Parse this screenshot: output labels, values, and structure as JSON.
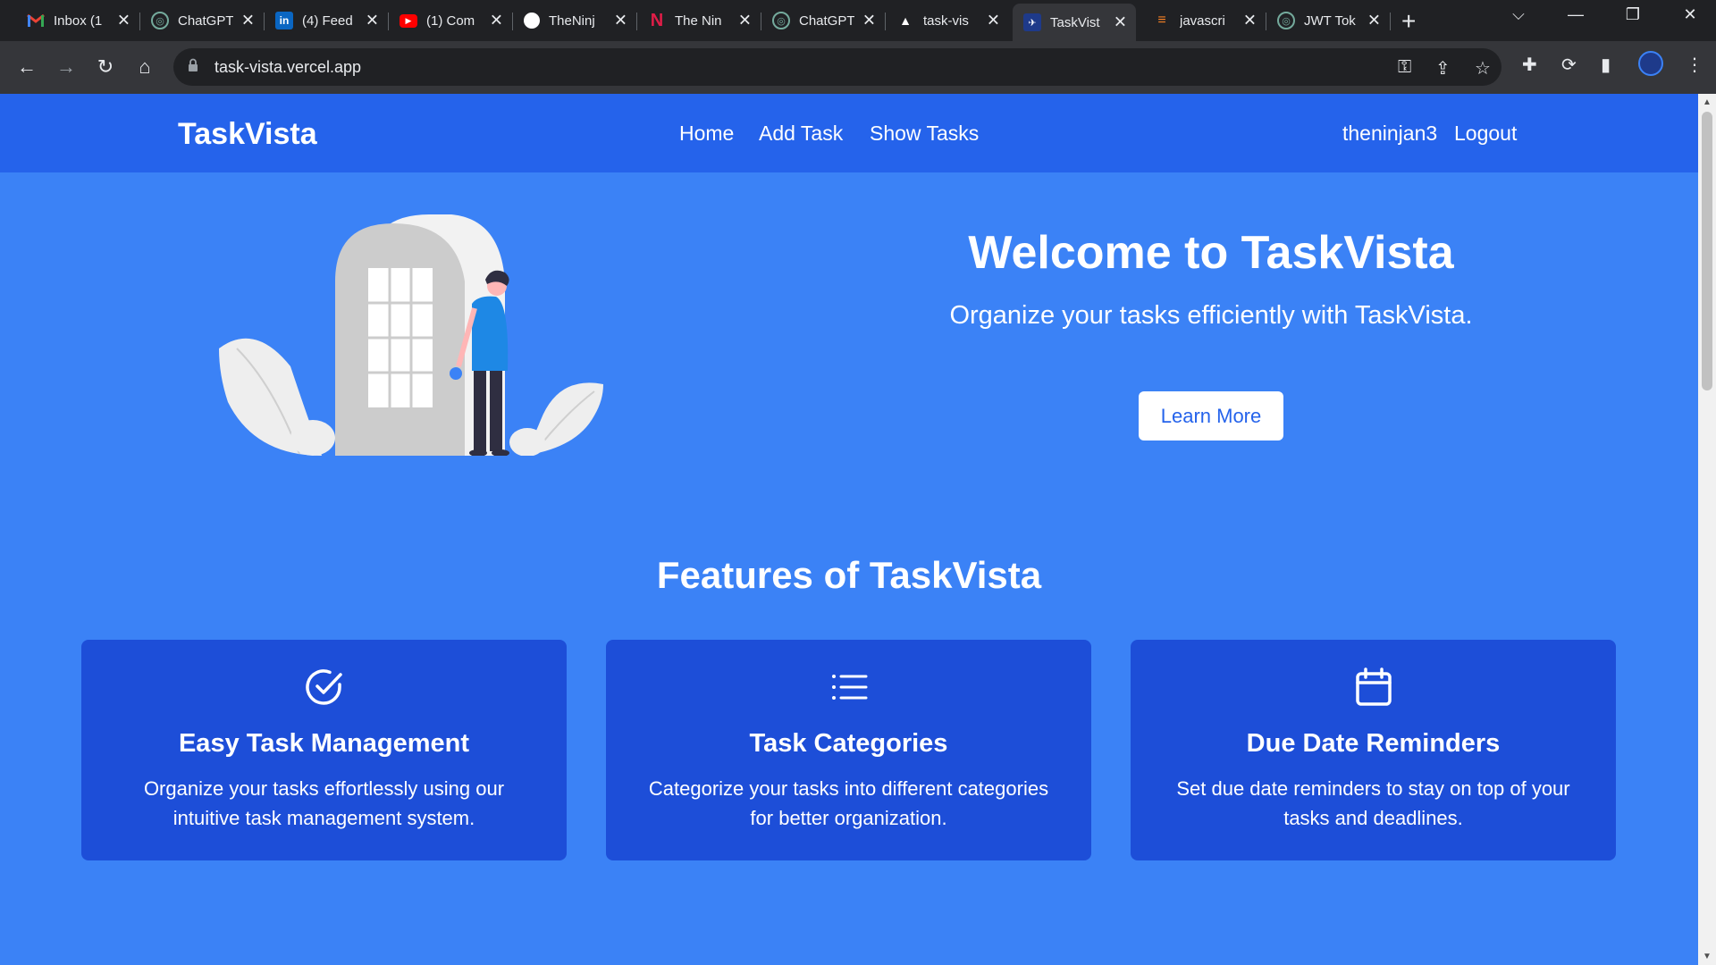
{
  "browser": {
    "tabs": [
      {
        "label": "Inbox (1",
        "icon": "gmail-icon",
        "color": "#ea4335"
      },
      {
        "label": "ChatGPT",
        "icon": "chatgpt-icon",
        "color": "#74aa9c"
      },
      {
        "label": "(4) Feed",
        "icon": "linkedin-icon",
        "color": "#0a66c2"
      },
      {
        "label": "(1) Com",
        "icon": "youtube-icon",
        "color": "#ff0000"
      },
      {
        "label": "TheNinj",
        "icon": "github-icon",
        "color": "#ffffff"
      },
      {
        "label": "The Nin",
        "icon": "n-logo-icon",
        "color": "#e11d48"
      },
      {
        "label": "ChatGPT",
        "icon": "chatgpt-icon",
        "color": "#74aa9c"
      },
      {
        "label": "task-vis",
        "icon": "vercel-icon",
        "color": "#ffffff"
      },
      {
        "label": "TaskVist",
        "icon": "taskvista-icon",
        "color": "#1d4ed8",
        "active": true
      },
      {
        "label": "javascri",
        "icon": "stackoverflow-icon",
        "color": "#f48024"
      },
      {
        "label": "JWT Tok",
        "icon": "chatgpt-icon",
        "color": "#74aa9c"
      }
    ],
    "url": "task-vista.vercel.app"
  },
  "site": {
    "brand": "TaskVista",
    "nav": {
      "home": "Home",
      "add_task": "Add Task",
      "show_tasks": "Show Tasks",
      "username": "theninjan3",
      "logout": "Logout"
    },
    "hero": {
      "title": "Welcome to TaskVista",
      "subtitle": "Organize your tasks efficiently with TaskVista.",
      "button": "Learn More"
    },
    "features": {
      "title": "Features of TaskVista",
      "cards": [
        {
          "icon": "check-circle-icon",
          "title": "Easy Task Management",
          "desc": "Organize your tasks effortlessly using our intuitive task management system."
        },
        {
          "icon": "list-icon",
          "title": "Task Categories",
          "desc": "Categorize your tasks into different categories for better organization."
        },
        {
          "icon": "calendar-icon",
          "title": "Due Date Reminders",
          "desc": "Set due date reminders to stay on top of your tasks and deadlines."
        }
      ]
    }
  },
  "colors": {
    "page_bg": "#3b82f6",
    "nav_bg": "#2563eb",
    "card_bg": "#1d4ed8",
    "button_text": "#2563eb"
  }
}
